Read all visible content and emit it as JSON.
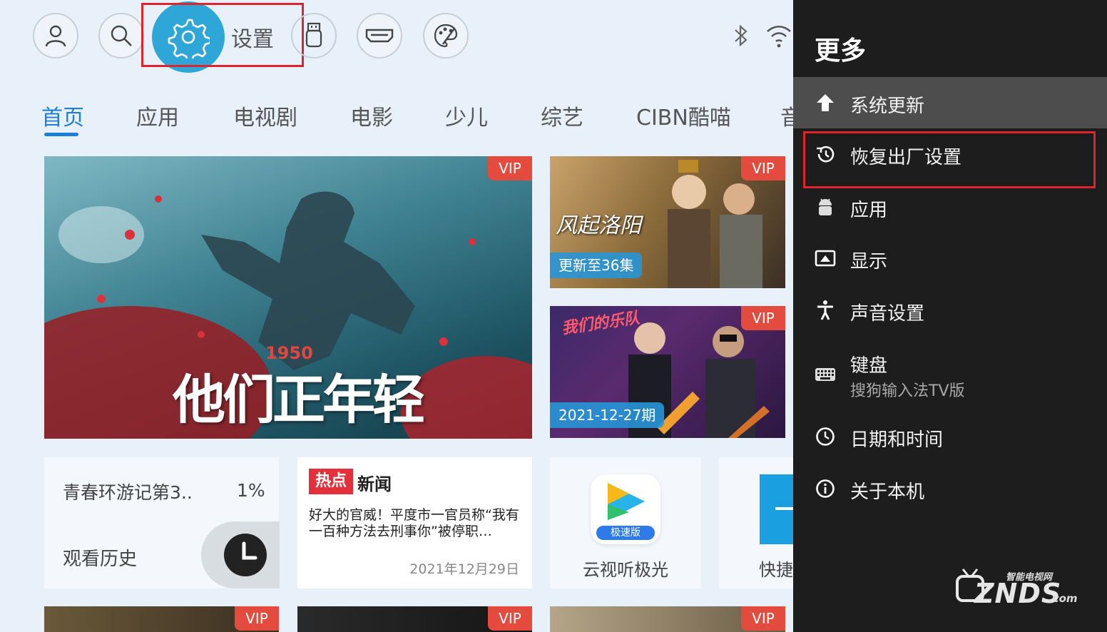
{
  "topbar": {
    "settings_label": "设置",
    "icons": [
      "user-icon",
      "search-icon",
      "settings-gear-icon",
      "usb-icon",
      "hdmi-icon",
      "palette-icon",
      "bluetooth-icon",
      "wifi-icon"
    ]
  },
  "tabs": [
    {
      "label": "首页",
      "active": true
    },
    {
      "label": "应用"
    },
    {
      "label": "电视剧"
    },
    {
      "label": "电影"
    },
    {
      "label": "少儿"
    },
    {
      "label": "综艺"
    },
    {
      "label": "CIBN酷喵"
    },
    {
      "label": "音"
    }
  ],
  "posters": {
    "main": {
      "vip": "VIP",
      "title_art": "他们正年轻",
      "year": "1950"
    },
    "top_right": {
      "vip": "VIP",
      "badge": "更新至36集",
      "title_art": "风起洛阳"
    },
    "mid_right": {
      "vip": "VIP",
      "badge": "2021-12-27期",
      "title_art": "我们的乐队"
    }
  },
  "history_tile": {
    "title": "青春环游记第3..",
    "progress": "1%",
    "label": "观看历史"
  },
  "news_tile": {
    "tag": "热点",
    "heading": "新闻",
    "body": "好大的官威！平度市一官员称“我有一百种方法去刑事你”被停职…",
    "date": "2021年12月29日"
  },
  "app_tile": {
    "badge": "极速版",
    "label": "云视听极光"
  },
  "shortcut_tile": {
    "label": "快捷"
  },
  "bottom_row": {
    "vip": "VIP"
  },
  "panel": {
    "title": "更多",
    "items": [
      {
        "label": "系统更新",
        "icon": "arrow-up-icon"
      },
      {
        "label": "恢复出厂设置",
        "icon": "history-restore-icon"
      },
      {
        "label": "应用",
        "icon": "android-icon"
      },
      {
        "label": "显示",
        "icon": "display-icon"
      },
      {
        "label": "声音设置",
        "icon": "accessibility-icon"
      },
      {
        "label": "键盘",
        "sub": "搜狗输入法TV版",
        "icon": "keyboard-icon"
      },
      {
        "label": "日期和时间",
        "icon": "clock-icon"
      },
      {
        "label": "关于本机",
        "icon": "info-icon"
      }
    ]
  },
  "watermark": {
    "text": "ZNDS",
    "sub": "智能电视网",
    "suffix": ".com"
  },
  "colors": {
    "accent": "#1e7fd8",
    "vip": "#e34b3e",
    "highlight_box": "#e0242d",
    "panel_bg": "#1d1d1d"
  }
}
